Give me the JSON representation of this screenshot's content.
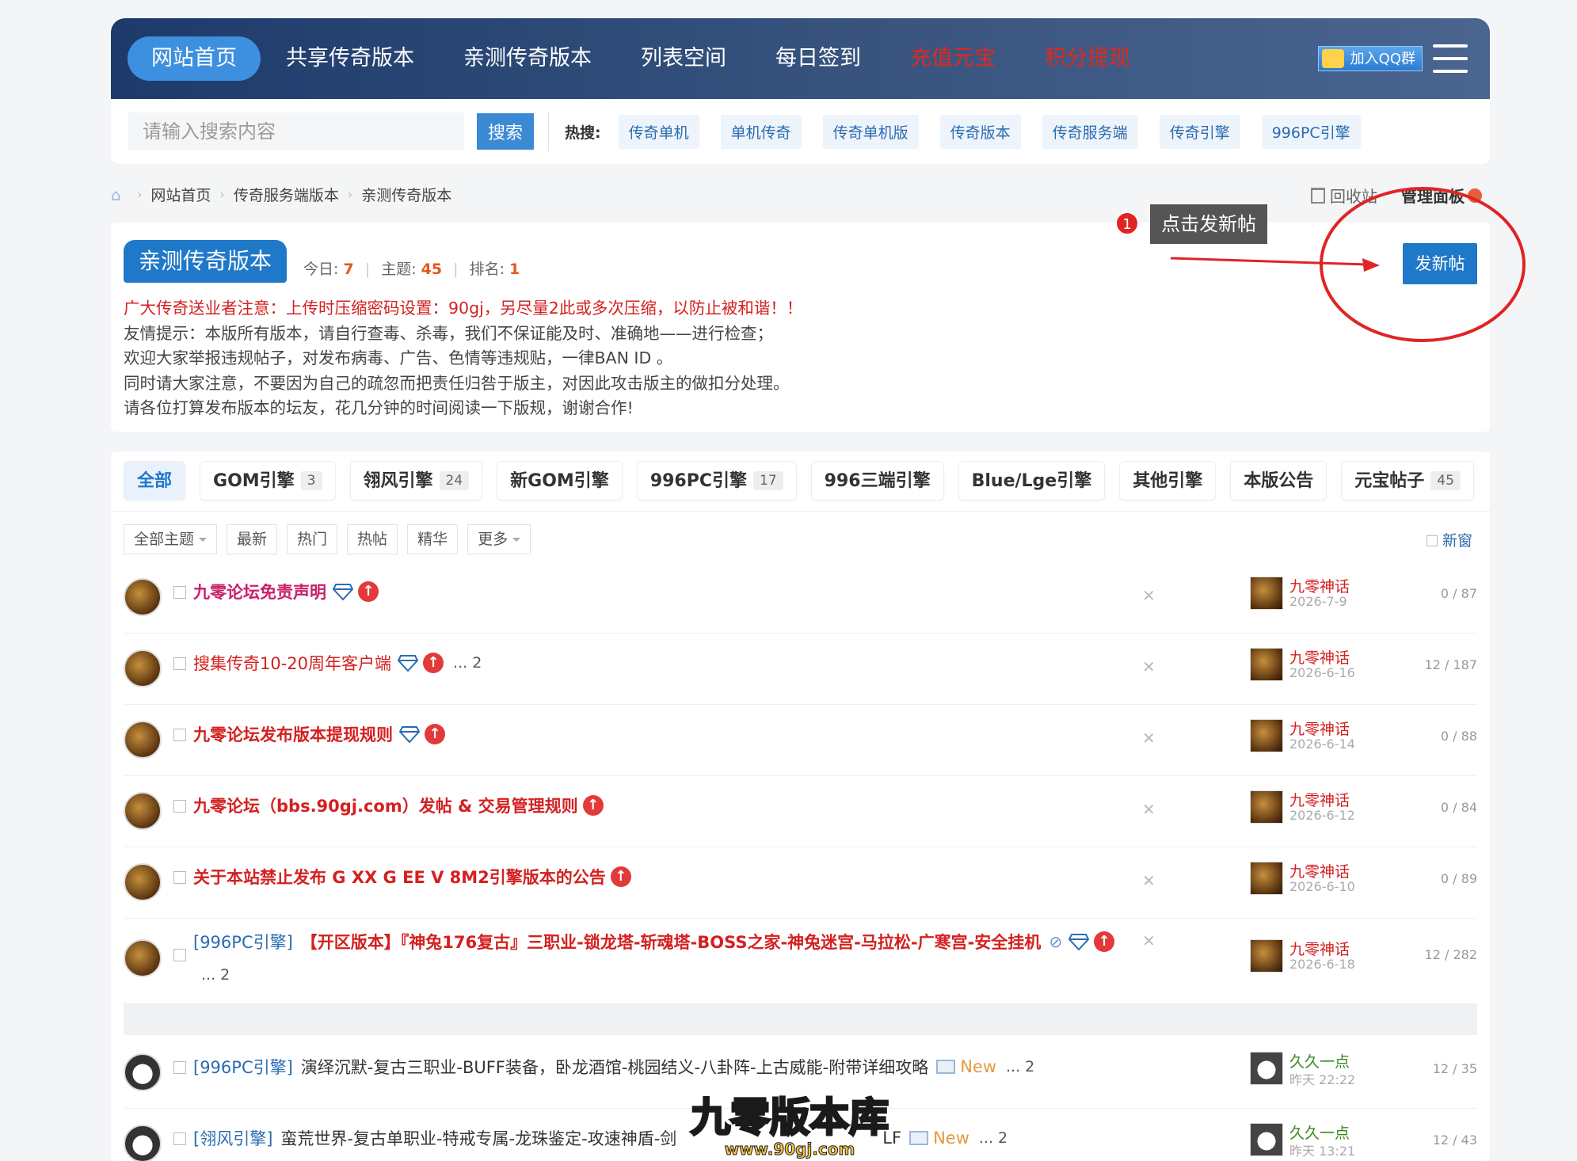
{
  "nav": {
    "items": [
      {
        "label": "网站首页",
        "active": true
      },
      {
        "label": "共享传奇版本"
      },
      {
        "label": "亲测传奇版本"
      },
      {
        "label": "列表空间"
      },
      {
        "label": "每日签到"
      },
      {
        "label": "充值元宝",
        "highlight": "red"
      },
      {
        "label": "积分提现",
        "highlight": "red"
      }
    ],
    "qq_label": "加入QQ群"
  },
  "search": {
    "placeholder": "请输入搜索内容",
    "button": "搜索",
    "hot_label": "热搜:",
    "hot_tags": [
      "传奇单机",
      "单机传奇",
      "传奇单机版",
      "传奇版本",
      "传奇服务端",
      "传奇引擎",
      "996PC引擎"
    ]
  },
  "breadcrumb": [
    "网站首页",
    "传奇服务端版本",
    "亲测传奇版本"
  ],
  "top_links": {
    "recycle": "回收站",
    "admin": "管理面板"
  },
  "forum": {
    "name": "亲测传奇版本",
    "today_label": "今日:",
    "today": "7",
    "topics_label": "主题:",
    "topics": "45",
    "rank_label": "排名:",
    "rank": "1",
    "notice": [
      "广大传奇送业者注意：上传时压缩密码设置：90gj，另尽量2此或多次压缩，以防止被和谐！！",
      "友情提示：本版所有版本，请自行查毒、杀毒，我们不保证能及时、准确地——进行检查；",
      "欢迎大家举报违规帖子，对发布病毒、广告、色情等违规贴，一律BAN ID 。",
      "同时请大家注意，不要因为自己的疏忽而把责任归咎于版主，对因此攻击版主的做扣分处理。",
      "请各位打算发布版本的坛友，花几分钟的时间阅读一下版规，谢谢合作!"
    ],
    "new_post": "发新帖"
  },
  "annotation": {
    "number": "1",
    "tip": "点击发新帖",
    "color": "#e02424"
  },
  "tabs": [
    {
      "label": "全部",
      "active": true
    },
    {
      "label": "GOM引擎",
      "count": "3"
    },
    {
      "label": "翎风引擎",
      "count": "24"
    },
    {
      "label": "新GOM引擎"
    },
    {
      "label": "996PC引擎",
      "count": "17"
    },
    {
      "label": "996三端引擎"
    },
    {
      "label": "Blue/Lge引擎"
    },
    {
      "label": "其他引擎"
    },
    {
      "label": "本版公告"
    },
    {
      "label": "元宝帖子",
      "count": "45"
    }
  ],
  "filters": [
    "全部主题",
    "最新",
    "热门",
    "热帖",
    "精华",
    "更多"
  ],
  "new_window": "新窗",
  "threads": [
    {
      "title": "九零论坛免责声明",
      "author": "九零神话",
      "date": "2026-7-9",
      "counts": "0 / 87"
    },
    {
      "title": "搜集传奇10-20周年客户端",
      "pages": "... 2",
      "author": "九零神话",
      "date": "2026-6-16",
      "counts": "12 / 187"
    },
    {
      "title": "九零论坛发布版本提现规则",
      "author": "九零神话",
      "date": "2026-6-14",
      "counts": "0 / 88"
    },
    {
      "title": "九零论坛（bbs.90gj.com）发帖 & 交易管理规则",
      "author": "九零神话",
      "date": "2026-6-12",
      "counts": "0 / 84"
    },
    {
      "title": "关于本站禁止发布 G XX G EE V 8M2引擎版本的公告",
      "author": "九零神话",
      "date": "2026-6-10",
      "counts": "0 / 89"
    },
    {
      "prefix": "[996PC引擎]",
      "title": "【开区版本】『神兔176复古』三职业-锁龙塔-斩魂塔-BOSS之家-神兔迷宫-马拉松-广寒宫-安全挂机",
      "pages": "... 2",
      "author": "九零神话",
      "date": "2026-6-18",
      "counts": "12 / 282"
    },
    {
      "prefix": "[996PC引擎]",
      "title": "演绎沉默-复古三职业-BUFF装备，卧龙酒馆-桃园结义-八卦阵-上古威能-附带详细攻略",
      "new": "New",
      "pages": "... 2",
      "author": "久久一点",
      "date": "昨天 22:22",
      "counts": "12 / 35"
    },
    {
      "prefix": "[翎风引擎]",
      "title": "蛮荒世界-复古单职业-特戒专属-龙珠鉴定-攻速神盾-剑",
      "title_tail": "LF",
      "new": "New",
      "pages": "... 2",
      "author": "久久一点",
      "date": "昨天 13:21",
      "counts": "12 / 43"
    }
  ],
  "watermark": {
    "title": "九零版本库",
    "url": "www.90gj.com"
  }
}
